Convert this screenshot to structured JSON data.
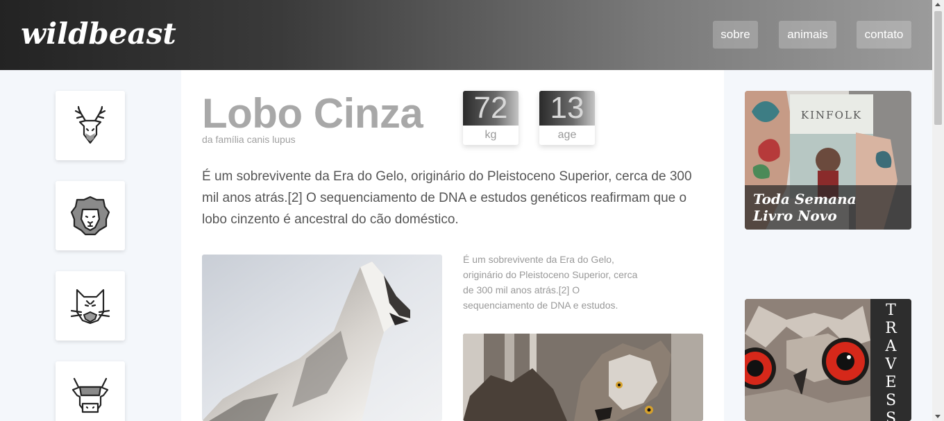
{
  "header": {
    "logo": "wildbeast",
    "nav": [
      {
        "label": "sobre"
      },
      {
        "label": "animais"
      },
      {
        "label": "contato"
      }
    ]
  },
  "sidebar": {
    "items": [
      {
        "icon": "deer-icon"
      },
      {
        "icon": "lion-icon"
      },
      {
        "icon": "cat-icon"
      },
      {
        "icon": "cow-icon"
      }
    ]
  },
  "animal": {
    "name": "Lobo Cinza",
    "family": "da família canis lupus",
    "stats": [
      {
        "value": "72",
        "unit": "kg"
      },
      {
        "value": "13",
        "unit": "age"
      }
    ],
    "description": "É um sobrevivente da Era do Gelo, originário do Pleistoceno Superior, cerca de 300 mil anos atrás.[2] O sequenciamento de DNA e estudos genéticos reafirmam que o lobo cinzento é ancestral do cão doméstico.",
    "caption": "É um sobrevivente da Era do Gelo, originário do Pleistoceno Superior, cerca de 300 mil anos atrás.[2] O sequenciamento de DNA e estudos."
  },
  "ads": [
    {
      "magazine": "KINFOLK",
      "caption_line1": "Toda Semana",
      "caption_line2": "Livro Novo"
    },
    {
      "vertical_text": [
        "T",
        "R",
        "A",
        "V",
        "E",
        "S",
        "S"
      ]
    }
  ],
  "colors": {
    "accent_text": "#a8a8a8",
    "owl_eye": "#d6281a"
  }
}
